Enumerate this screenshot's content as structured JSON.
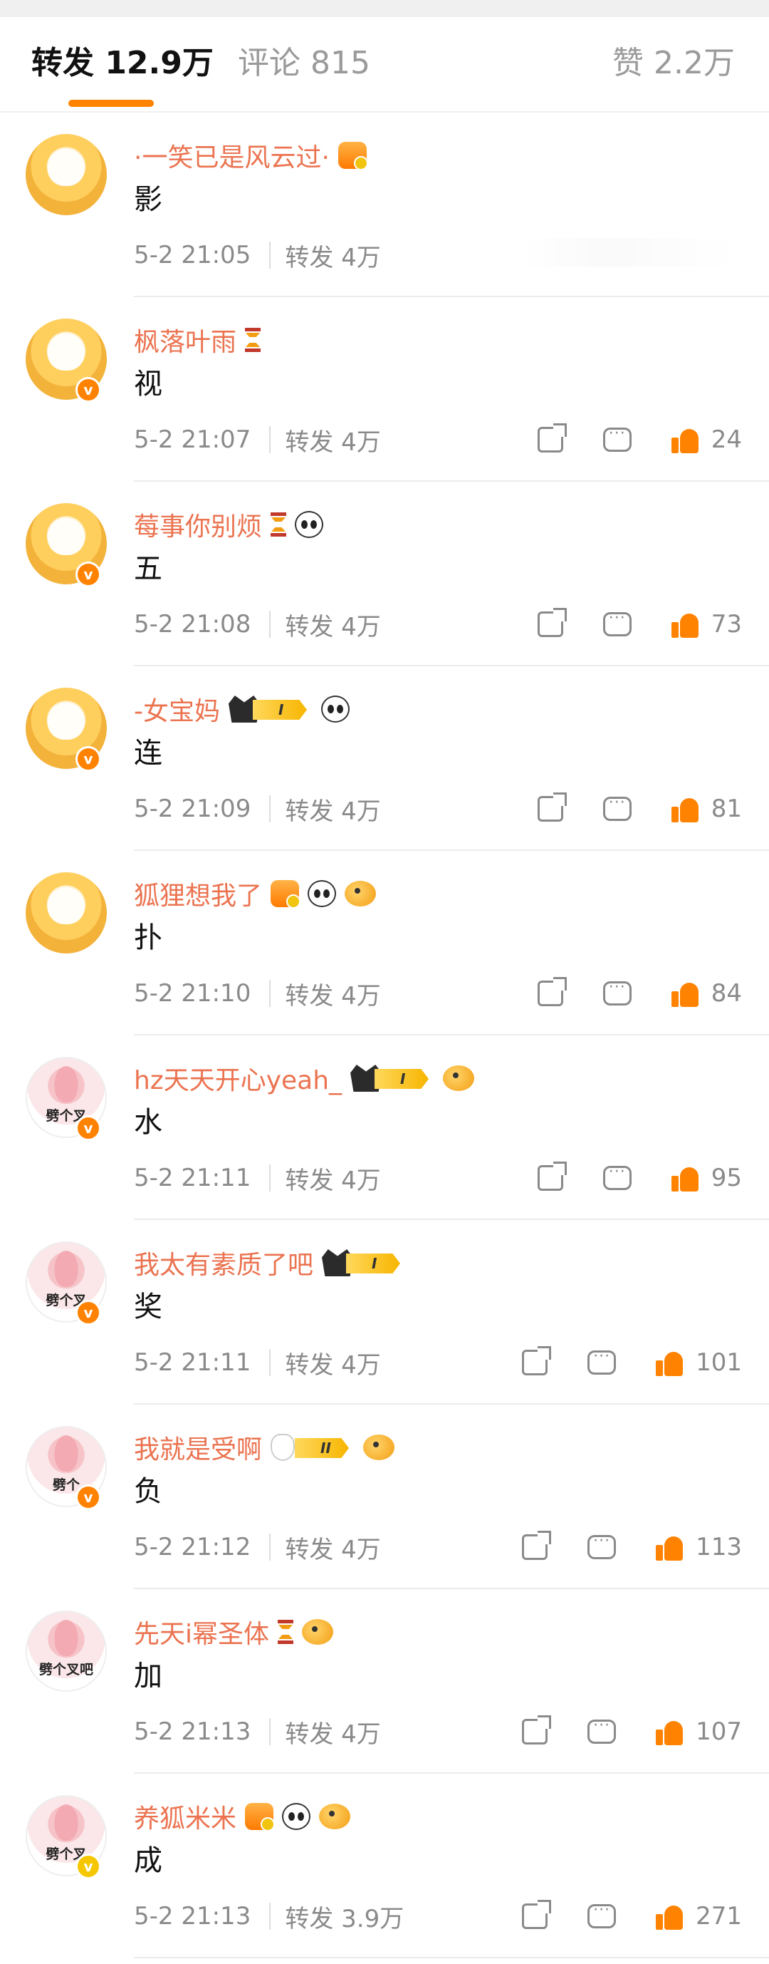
{
  "tabs": {
    "repost": "转发 12.9万",
    "comments": "评论 815",
    "likes": "赞 2.2万"
  },
  "colors": {
    "accent": "#ff8200",
    "name": "#eb7350",
    "meta": "#8a8a8a"
  },
  "reposts": [
    {
      "name": "·一笑已是风云过·",
      "content": "影",
      "time": "5-2 21:05",
      "reposts": "转发 4万",
      "likes": "",
      "avatar": "chick-avatar",
      "avatar_text": "",
      "verified": false,
      "badges": [
        "crown-badge"
      ]
    },
    {
      "name": "枫落叶雨",
      "content": "视",
      "time": "5-2 21:07",
      "reposts": "转发 4万",
      "likes": "24",
      "avatar": "chick-avatar",
      "avatar_text": "",
      "verified": true,
      "badges": [
        "hourglass-icon"
      ]
    },
    {
      "name": "莓事你别烦",
      "content": "五",
      "time": "5-2 21:08",
      "reposts": "转发 4万",
      "likes": "73",
      "avatar": "chick-avatar",
      "avatar_text": "",
      "verified": true,
      "badges": [
        "hourglass-icon",
        "panda-icon"
      ]
    },
    {
      "name": "-女宝妈",
      "content": "连",
      "time": "5-2 21:09",
      "reposts": "转发 4万",
      "likes": "81",
      "avatar": "chick-avatar",
      "avatar_text": "",
      "verified": true,
      "badges": [
        "vip-badge",
        "panda-icon"
      ]
    },
    {
      "name": "狐狸想我了",
      "content": "扑",
      "time": "5-2 21:10",
      "reposts": "转发 4万",
      "likes": "84",
      "avatar": "chick-avatar",
      "avatar_text": "",
      "verified": false,
      "badges": [
        "crown-badge",
        "panda-icon",
        "fish-icon"
      ]
    },
    {
      "name": "hz天天开心yeah_",
      "content": "水",
      "time": "5-2 21:11",
      "reposts": "转发 4万",
      "likes": "95",
      "avatar": "pink-avatar",
      "avatar_text": "劈个叉",
      "verified": true,
      "badges": [
        "vip-badge",
        "fish-icon"
      ]
    },
    {
      "name": "我太有素质了吧",
      "content": "奖",
      "time": "5-2 21:11",
      "reposts": "转发 4万",
      "likes": "101",
      "avatar": "pink-avatar",
      "avatar_text": "劈个叉",
      "verified": true,
      "badges": [
        "vip-badge"
      ]
    },
    {
      "name": "我就是受啊",
      "content": "负",
      "time": "5-2 21:12",
      "reposts": "转发 4万",
      "likes": "113",
      "avatar": "pink-avatar",
      "avatar_text": "劈个",
      "verified": true,
      "badges": [
        "vip-bunny-badge",
        "fish-icon"
      ]
    },
    {
      "name": "先天i幂圣体",
      "content": "加",
      "time": "5-2 21:13",
      "reposts": "转发 4万",
      "likes": "107",
      "avatar": "pink-avatar",
      "avatar_text": "劈个叉吧",
      "verified": false,
      "badges": [
        "hourglass-icon",
        "fish-icon"
      ]
    },
    {
      "name": "养狐米米",
      "content": "成",
      "time": "5-2 21:13",
      "reposts": "转发 3.9万",
      "likes": "271",
      "avatar": "pink-avatar",
      "avatar_text": "劈个叉",
      "verified": true,
      "verified_gold": true,
      "badges": [
        "crown-badge",
        "panda-icon",
        "fish-icon"
      ]
    }
  ],
  "vip_level": "I",
  "vip_level_2": "II"
}
